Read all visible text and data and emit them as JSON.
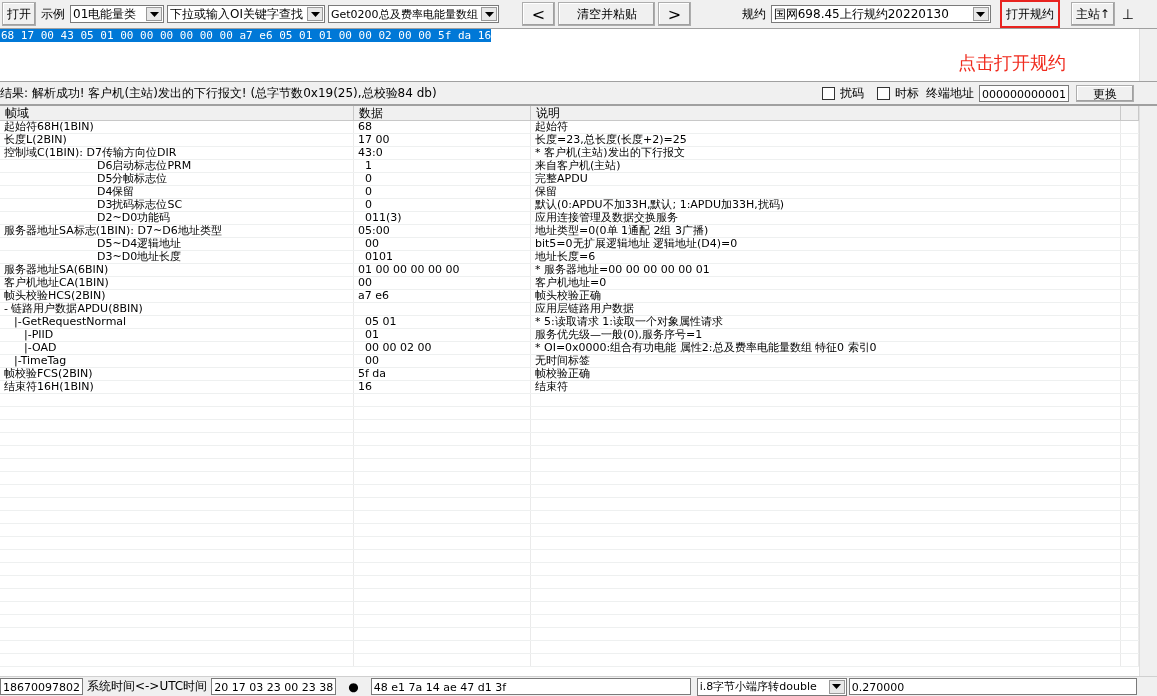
{
  "toolbar": {
    "open_button": "打开",
    "example_label": "示例",
    "category_select": "01电能量类",
    "search_select": {
      "placeholder": "下拉或输入OI关键字查找"
    },
    "command_select": "Get0200总及费率电能量数组",
    "prev_button": "<",
    "clear_paste_button": "清空并粘贴",
    "next_button": ">",
    "protocol_label": "规约",
    "protocol_select": "国网698.45上行规约20220130",
    "open_protocol_button": {
      "label": "打开规约",
      "highlighted": true
    },
    "master_button": "主站↑",
    "pin_button": "⊥"
  },
  "hex_input": {
    "value": "68 17 00 43 05 01 00 00 00 00 00 00 a7 e6 05 01 01 00 00 02 00 00 5f da 16",
    "selected": true
  },
  "annotation": "点击打开规约",
  "result_bar": {
    "text": "结果: 解析成功! 客户机(主站)发出的下行报文! (总字节数0x19(25),总校验84 db)",
    "scramble": {
      "label": "扰码",
      "checked": false
    },
    "timestamp": {
      "label": "时标",
      "checked": false
    },
    "address_label": "终端地址",
    "address": "000000000001",
    "change_button": "更换"
  },
  "table": {
    "columns": [
      "帧域",
      "数据",
      "说明"
    ],
    "rows": [
      {
        "field": "起始符68H(1BIN)",
        "data": "68",
        "note": "起始符"
      },
      {
        "field": "长度L(2BIN)",
        "data": "17 00",
        "note": "长度=23,总长度(长度+2)=25"
      },
      {
        "field": "控制域C(1BIN): D7传输方向位DIR",
        "data": "43:0",
        "note": "* 客户机(主站)发出的下行报文",
        "kind": "bitfield",
        "children": [
          {
            "field": "D6启动标志位PRM",
            "data": "1",
            "note": "来自客户机(主站)"
          },
          {
            "field": "D5分帧标志位",
            "data": "0",
            "note": "完整APDU"
          },
          {
            "field": "D4保留",
            "data": "0",
            "note": "保留"
          },
          {
            "field": "D3扰码标志位SC",
            "data": "0",
            "note": "默认(0:APDU不加33H,默认; 1:APDU加33H,扰码)"
          },
          {
            "field": "D2~D0功能码",
            "data": "011(3)",
            "note": "应用连接管理及数据交换服务"
          }
        ]
      },
      {
        "field": "服务器地址SA标志(1BIN): D7~D6地址类型",
        "data": "05:00",
        "note": "地址类型=0(0单 1通配 2组 3广播)",
        "kind": "bitfield",
        "children": [
          {
            "field": "D5~D4逻辑地址",
            "data": "00",
            "note": "bit5=0无扩展逻辑地址 逻辑地址(D4)=0"
          },
          {
            "field": "D3~D0地址长度",
            "data": "0101",
            "note": "地址长度=6"
          }
        ]
      },
      {
        "field": "服务器地址SA(6BIN)",
        "data": "01 00 00 00 00 00",
        "note": "* 服务器地址=00 00 00 00 00 01"
      },
      {
        "field": "客户机地址CA(1BIN)",
        "data": "00",
        "note": "客户机地址=0"
      },
      {
        "field": "帧头校验HCS(2BIN)",
        "data": "a7 e6",
        "note": "帧头校验正确"
      },
      {
        "field": "- 链路用户数据APDU(8BIN)",
        "note": "应用层链路用户数据",
        "kind": "tree",
        "children": [
          {
            "field": "|-GetRequestNormal",
            "data": "05 01",
            "note": "* 5:读取请求 1:读取一个对象属性请求",
            "kind": "tree",
            "children": [
              {
                "field": "|-PIID",
                "data": "01",
                "note": "服务优先级—一般(0),服务序号=1"
              },
              {
                "field": "|-OAD",
                "data": "00 00 02 00",
                "note": "* OI=0x0000:组合有功电能 属性2:总及费率电能量数组 特征0 索引0"
              }
            ]
          },
          {
            "field": "|-TimeTag",
            "data": "00",
            "note": "无时间标签"
          }
        ]
      },
      {
        "field": "帧校验FCS(2BIN)",
        "data": "5f da",
        "note": "帧校验正确"
      },
      {
        "field": "结束符16H(1BIN)",
        "data": "16",
        "note": "结束符"
      }
    ]
  },
  "status_bar": {
    "phone": "18670097802",
    "time_label": "系统时间<->UTC时间",
    "time_value": "20 17 03 23 00 23 38",
    "dot": "●",
    "hex_value": "48 e1 7a 14 ae 47 d1 3f",
    "convert_select": "i.8字节小端序转double",
    "result": "0.270000"
  }
}
